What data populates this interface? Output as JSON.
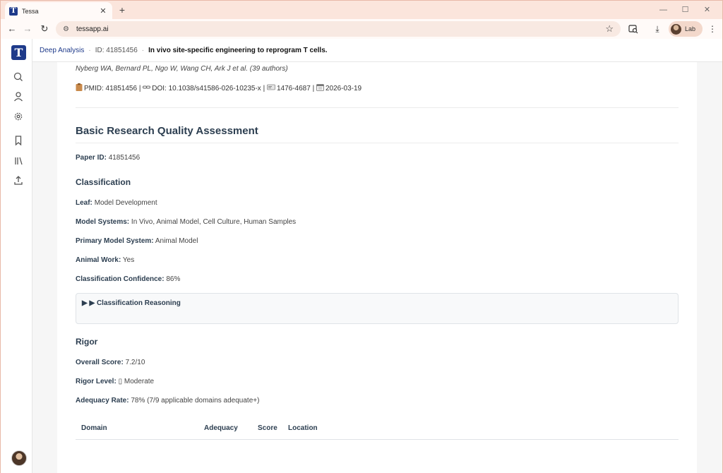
{
  "browser": {
    "tab_title": "Tessa",
    "tab_favicon_letter": "T",
    "url": "tessapp.ai",
    "profile_label": "Lab"
  },
  "app": {
    "logo_letter": "T",
    "breadcrumb": {
      "section": "Deep Analysis",
      "id": "ID: 41851456",
      "title": "In vivo site-specific engineering to reprogram T cells."
    }
  },
  "paper": {
    "authors": "Nyberg WA, Bernard PL, Ngo W, Wang CH, Ark J et al. (39 authors)",
    "pmid": "PMID: 41851456",
    "doi": "DOI: 10.1038/s41586-026-10235-x",
    "issn": "1476-4687",
    "date": "2026-03-19",
    "separator": "|"
  },
  "assessment": {
    "heading": "Basic Research Quality Assessment",
    "paper_id_label": "Paper ID:",
    "paper_id_value": "41851456",
    "classification": {
      "heading": "Classification",
      "leaf_label": "Leaf:",
      "leaf_value": "Model Development",
      "model_systems_label": "Model Systems:",
      "model_systems_value": "In Vivo, Animal Model, Cell Culture, Human Samples",
      "primary_label": "Primary Model System:",
      "primary_value": "Animal Model",
      "animal_label": "Animal Work:",
      "animal_value": "Yes",
      "confidence_label": "Classification Confidence:",
      "confidence_value": "86%",
      "reasoning_summary": "▶ ▶ Classification Reasoning"
    },
    "rigor": {
      "heading": "Rigor",
      "overall_label": "Overall Score:",
      "overall_value": "7.2/10",
      "level_label": "Rigor Level:",
      "level_value": "▯ Moderate",
      "adequacy_label": "Adequacy Rate:",
      "adequacy_value": "78% (7/9 applicable domains adequate+)",
      "table_headers": [
        "Domain",
        "Adequacy",
        "Score",
        "Location"
      ]
    }
  }
}
